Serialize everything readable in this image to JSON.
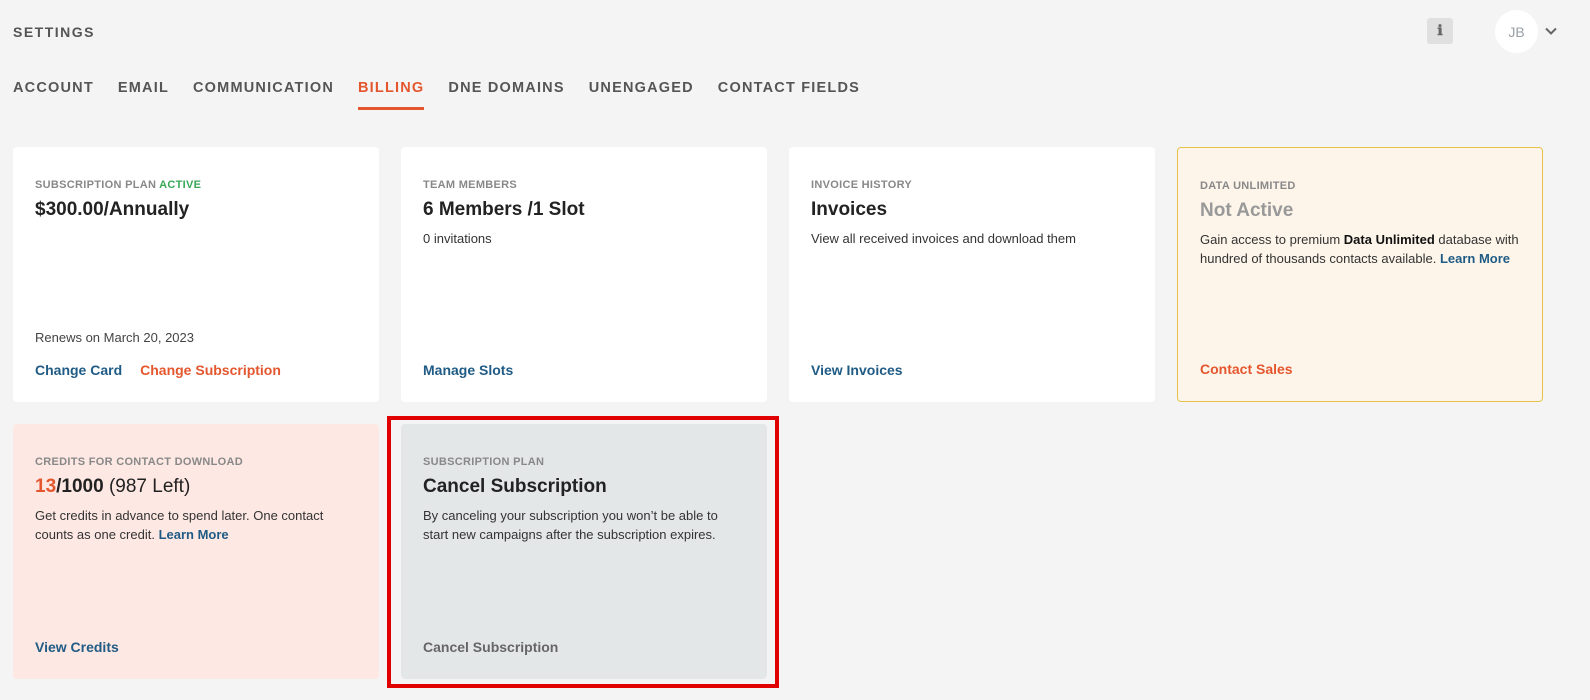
{
  "header": {
    "title": "SETTINGS",
    "info_icon": "info-icon",
    "avatar_initials": "JB"
  },
  "tabs": [
    {
      "label": "ACCOUNT",
      "active": false
    },
    {
      "label": "EMAIL",
      "active": false
    },
    {
      "label": "COMMUNICATION",
      "active": false
    },
    {
      "label": "BILLING",
      "active": true
    },
    {
      "label": "DNE DOMAINS",
      "active": false
    },
    {
      "label": "UNENGAGED",
      "active": false
    },
    {
      "label": "CONTACT FIELDS",
      "active": false
    }
  ],
  "cards": {
    "subscription": {
      "label": "SUBSCRIPTION PLAN",
      "status": "ACTIVE",
      "heading": "$300.00/Annually",
      "renews": "Renews on March 20, 2023",
      "link1": "Change Card",
      "link2": "Change Subscription"
    },
    "team": {
      "label": "TEAM MEMBERS",
      "heading": "6 Members /1 Slot",
      "desc": "0 invitations",
      "link": "Manage Slots"
    },
    "invoices": {
      "label": "INVOICE HISTORY",
      "heading": "Invoices",
      "desc": "View all received invoices and download them",
      "link": "View Invoices"
    },
    "data_unlimited": {
      "label": "DATA UNLIMITED",
      "heading": "Not Active",
      "desc_pre": "Gain access to premium ",
      "desc_bold": "Data Unlimited",
      "desc_post": " database with hundred of thousands contacts available. ",
      "learn_more": "Learn More",
      "link": "Contact Sales"
    },
    "credits": {
      "label": "CREDITS FOR CONTACT DOWNLOAD",
      "used": "13",
      "total": "/1000",
      "left": " (987 Left)",
      "desc_pre": "Get credits in advance to spend later. One contact counts as one credit. ",
      "learn_more": "Learn More",
      "link": "View Credits"
    },
    "cancel": {
      "label": "SUBSCRIPTION PLAN",
      "heading": "Cancel Subscription",
      "desc": "By canceling your subscription you won’t be able to start new campaigns after the subscription expires.",
      "link": "Cancel Subscription"
    }
  },
  "colors": {
    "accent": "#e4572e",
    "link": "#1f5b85",
    "active_status": "#3aa757",
    "highlight_border": "#e00000"
  }
}
